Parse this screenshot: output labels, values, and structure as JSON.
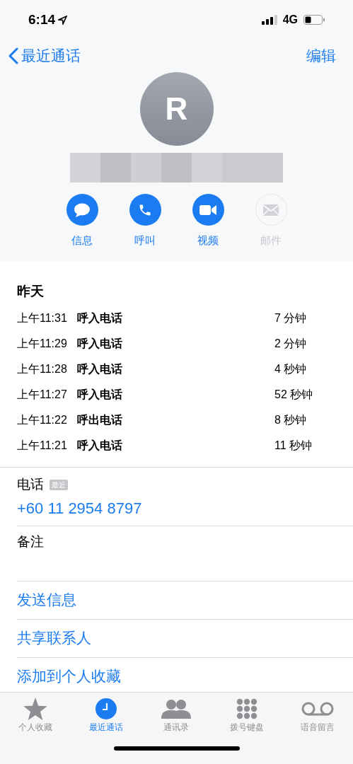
{
  "status_bar": {
    "time": "6:14",
    "network": "4G"
  },
  "nav": {
    "back": "最近通话",
    "edit": "编辑"
  },
  "contact": {
    "initial": "R"
  },
  "actions": [
    {
      "kind": "message",
      "label": "信息",
      "disabled": false
    },
    {
      "kind": "call",
      "label": "呼叫",
      "disabled": false
    },
    {
      "kind": "video",
      "label": "视频",
      "disabled": false
    },
    {
      "kind": "mail",
      "label": "邮件",
      "disabled": true
    }
  ],
  "history": {
    "date": "昨天",
    "calls": [
      {
        "time": "上午11:31",
        "type": "呼入电话",
        "duration": "7 分钟"
      },
      {
        "time": "上午11:29",
        "type": "呼入电话",
        "duration": "2 分钟"
      },
      {
        "time": "上午11:28",
        "type": "呼入电话",
        "duration": "4 秒钟"
      },
      {
        "time": "上午11:27",
        "type": "呼入电话",
        "duration": "52 秒钟"
      },
      {
        "time": "上午11:22",
        "type": "呼出电话",
        "duration": "8 秒钟"
      },
      {
        "time": "上午11:21",
        "type": "呼入电话",
        "duration": "11 秒钟"
      }
    ]
  },
  "phone": {
    "label": "电话",
    "badge": "最近",
    "number": "+60 11 2954 8797"
  },
  "notes": {
    "label": "备注"
  },
  "links": [
    "发送信息",
    "共享联系人",
    "添加到个人收藏"
  ],
  "tabs": [
    {
      "kind": "favorites",
      "label": "个人收藏",
      "selected": false
    },
    {
      "kind": "recents",
      "label": "最近通话",
      "selected": true
    },
    {
      "kind": "contacts",
      "label": "通讯录",
      "selected": false
    },
    {
      "kind": "keypad",
      "label": "拨号键盘",
      "selected": false
    },
    {
      "kind": "voicemail",
      "label": "语音留言",
      "selected": false
    }
  ]
}
